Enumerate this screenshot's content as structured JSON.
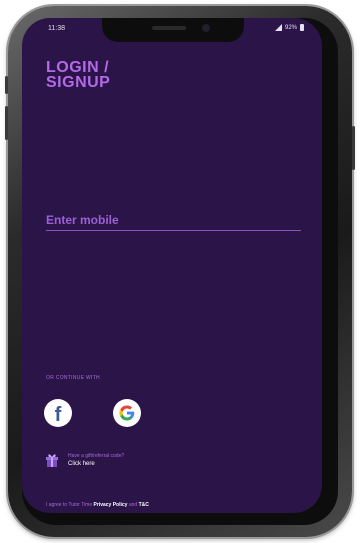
{
  "status_bar": {
    "time": "11:38",
    "battery": "92%"
  },
  "auth": {
    "title_line1": "LOGIN /",
    "title_line2": "SIGNUP",
    "mobile_placeholder": "Enter mobile"
  },
  "social": {
    "label": "OR CONTINUE WITH",
    "providers": [
      {
        "name": "Facebook",
        "icon": "facebook-icon",
        "color": "#3b5998"
      },
      {
        "name": "Google",
        "icon": "google-icon"
      }
    ]
  },
  "referral": {
    "icon": "gift-icon",
    "question": "Have a gift/referral code?",
    "action": "Click here"
  },
  "footer": {
    "prefix": "I agree to Tutor Time",
    "privacy": "Privacy Policy",
    "and": "and",
    "tnc": "T&C"
  },
  "colors": {
    "background": "#2b1448",
    "accent": "#b46ae8"
  }
}
